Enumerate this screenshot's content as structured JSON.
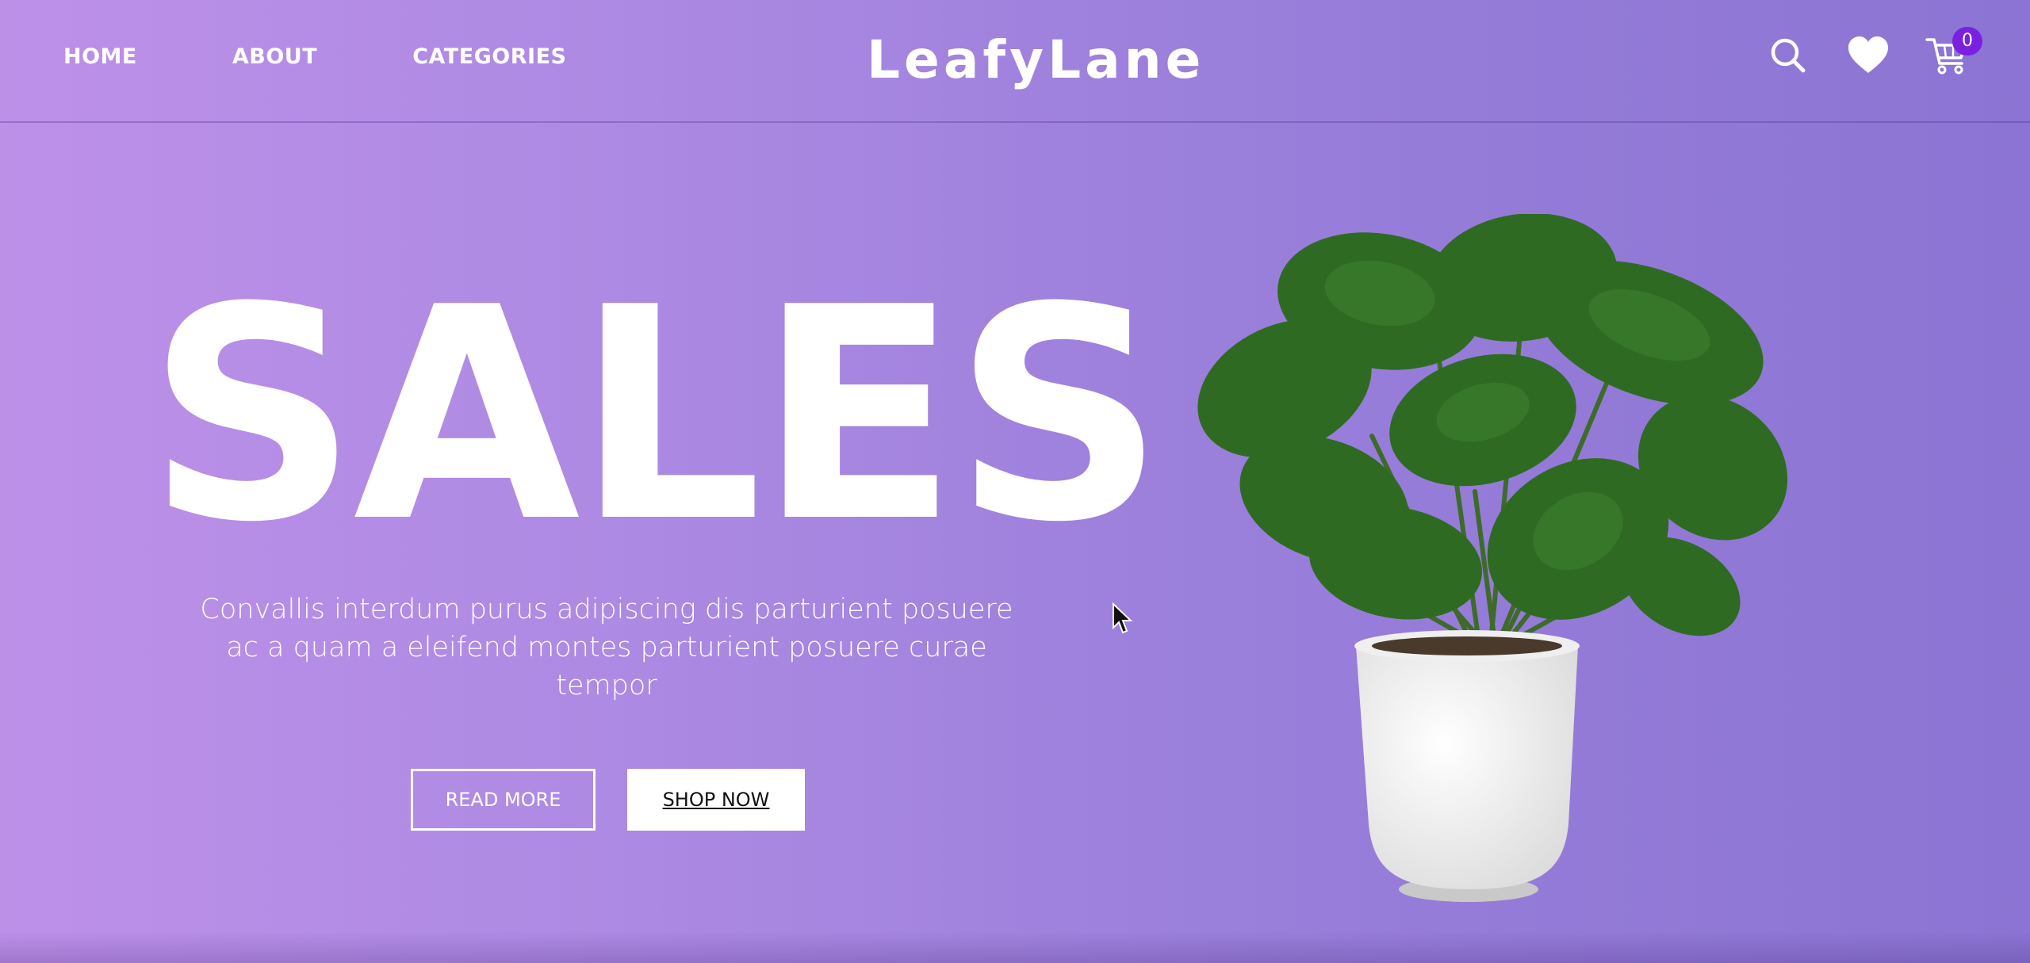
{
  "nav": {
    "items": [
      {
        "label": "HOME"
      },
      {
        "label": "ABOUT"
      },
      {
        "label": "CATEGORIES"
      }
    ]
  },
  "brand": {
    "name": "LeafyLane"
  },
  "header_icons": {
    "search": "search-icon",
    "wishlist": "heart-icon",
    "cart": "cart-icon",
    "cart_count": "0"
  },
  "hero": {
    "title": "SALES",
    "description": "Convallis interdum purus adipiscing dis parturient posuere ac a quam a eleifend montes parturient posuere curae tempor",
    "read_more_label": "READ MORE",
    "shop_now_label": "SHOP NOW",
    "image": "potted-monstera-plant"
  },
  "colors": {
    "background_start": "#bd90e8",
    "background_end": "#8b74d3",
    "text": "#ffffff",
    "badge": "#7a20e0",
    "leaf": "#2f6a22"
  }
}
